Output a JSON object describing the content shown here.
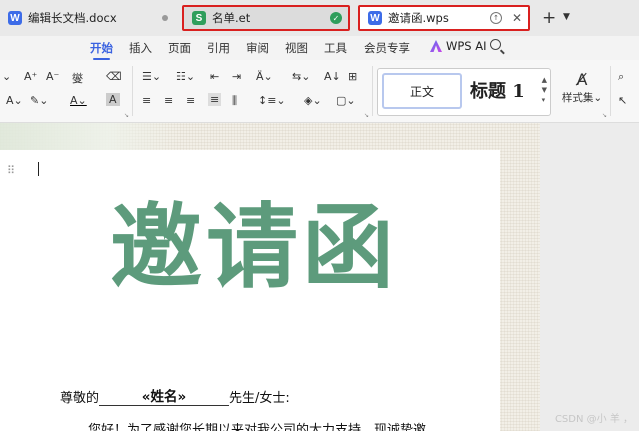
{
  "tabs": [
    {
      "icon": "W",
      "title": "编辑长文档.docx"
    },
    {
      "icon": "S",
      "title": "名单.et"
    },
    {
      "icon": "W",
      "title": "邀请函.wps"
    }
  ],
  "new_tab": "+",
  "menu": [
    "开始",
    "插入",
    "页面",
    "引用",
    "审阅",
    "视图",
    "工具",
    "会员专享"
  ],
  "wps_ai": "WPS AI",
  "ribbon": {
    "font_grow": "A⁺",
    "font_shrink": "A⁻",
    "phonetic": "燮",
    "clear": "⌫",
    "styles": {
      "normal": "正文",
      "heading1": "标题 1"
    },
    "style_set": "样式集"
  },
  "document": {
    "title": "邀请函",
    "greeting_prefix": "尊敬的",
    "greeting_field": "«姓名»",
    "greeting_suffix": "先生/女士:",
    "body_line": "您好！为了感谢您长期以来对我公司的大力支持，现诚挚邀"
  },
  "watermark": "CSDN @小 羊 ，"
}
